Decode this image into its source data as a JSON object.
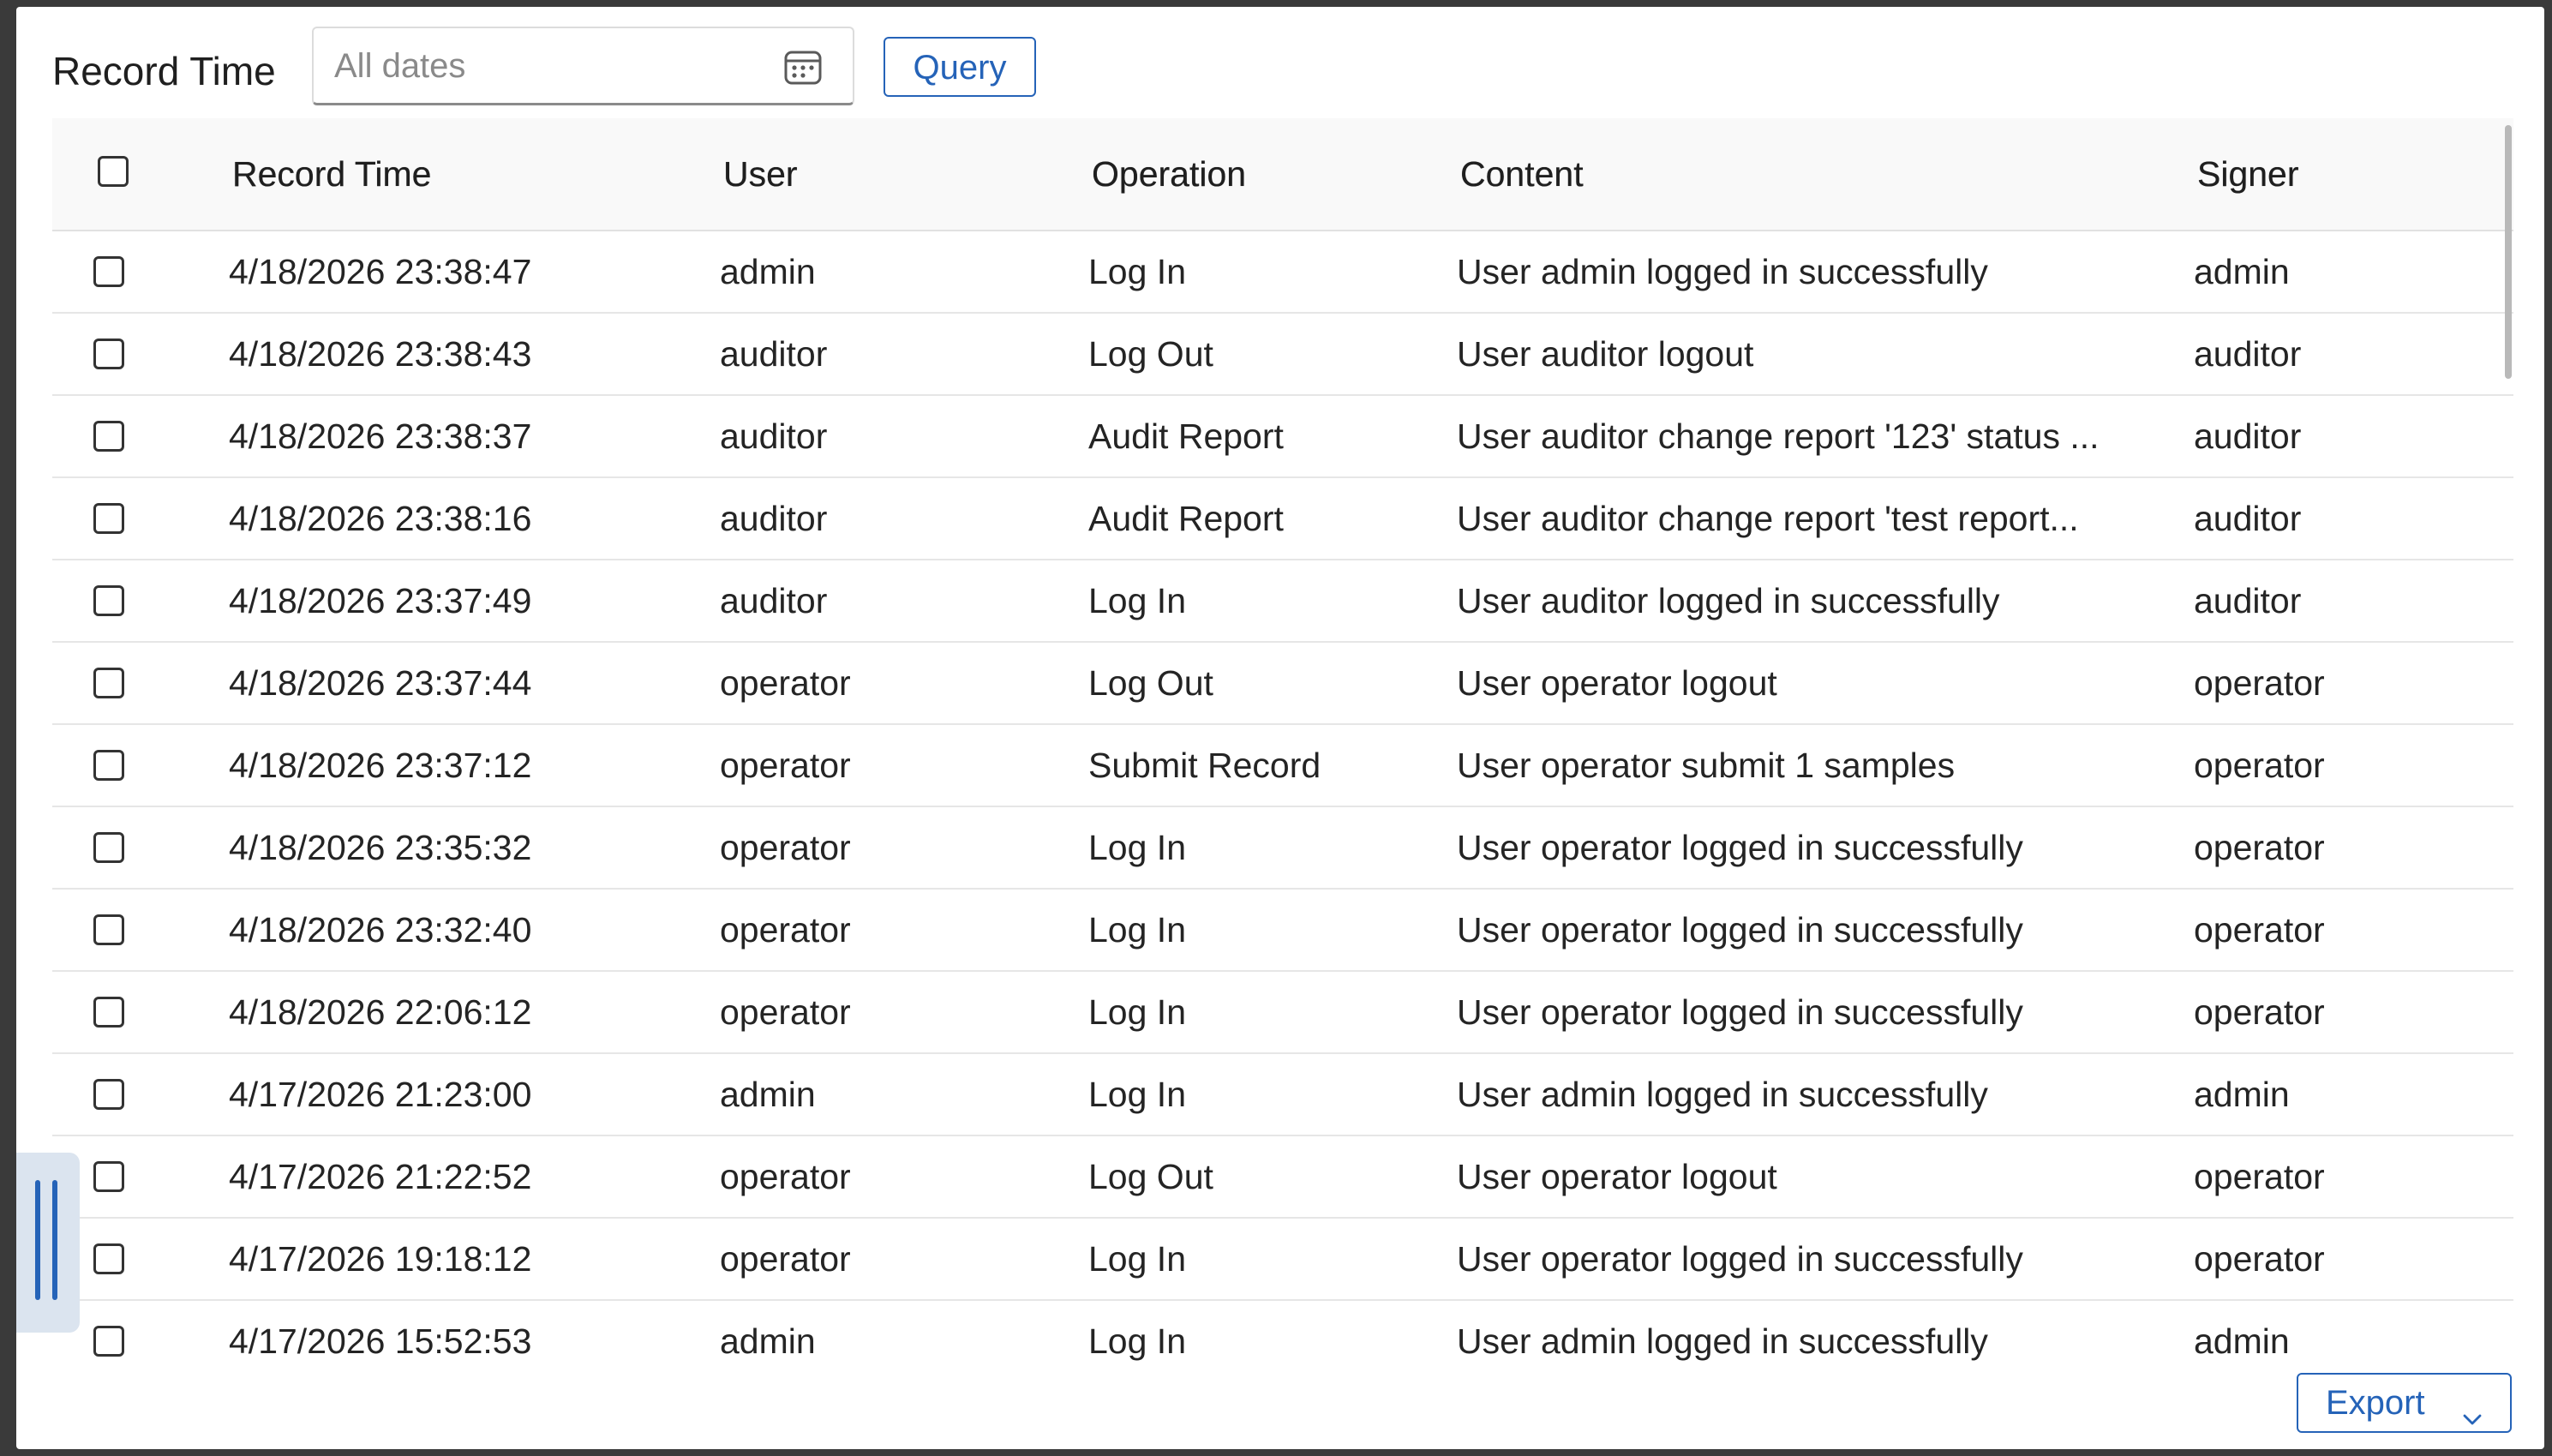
{
  "filter": {
    "label": "Record Time",
    "date_placeholder": "All dates",
    "date_value": "",
    "query_label": "Query"
  },
  "table": {
    "headers": {
      "record_time": "Record Time",
      "user": "User",
      "operation": "Operation",
      "content": "Content",
      "signer": "Signer"
    },
    "rows": [
      {
        "time": "4/18/2026 23:38:47",
        "user": "admin",
        "operation": "Log In",
        "content": "User admin logged in successfully",
        "signer": "admin"
      },
      {
        "time": "4/18/2026 23:38:43",
        "user": "auditor",
        "operation": "Log Out",
        "content": "User auditor logout",
        "signer": "auditor"
      },
      {
        "time": "4/18/2026 23:38:37",
        "user": "auditor",
        "operation": "Audit Report",
        "content": "User auditor change report '123' status ...",
        "signer": "auditor"
      },
      {
        "time": "4/18/2026 23:38:16",
        "user": "auditor",
        "operation": "Audit Report",
        "content": "User auditor change report 'test report...",
        "signer": "auditor"
      },
      {
        "time": "4/18/2026 23:37:49",
        "user": "auditor",
        "operation": "Log In",
        "content": "User auditor logged in successfully",
        "signer": "auditor"
      },
      {
        "time": "4/18/2026 23:37:44",
        "user": "operator",
        "operation": "Log Out",
        "content": "User operator logout",
        "signer": "operator"
      },
      {
        "time": "4/18/2026 23:37:12",
        "user": "operator",
        "operation": "Submit Record",
        "content": "User operator submit 1 samples",
        "signer": "operator"
      },
      {
        "time": "4/18/2026 23:35:32",
        "user": "operator",
        "operation": "Log In",
        "content": "User operator logged in successfully",
        "signer": "operator"
      },
      {
        "time": "4/18/2026 23:32:40",
        "user": "operator",
        "operation": "Log In",
        "content": "User operator logged in successfully",
        "signer": "operator"
      },
      {
        "time": "4/18/2026 22:06:12",
        "user": "operator",
        "operation": "Log In",
        "content": "User operator logged in successfully",
        "signer": "operator"
      },
      {
        "time": "4/17/2026 21:23:00",
        "user": "admin",
        "operation": "Log In",
        "content": "User admin logged in successfully",
        "signer": "admin"
      },
      {
        "time": "4/17/2026 21:22:52",
        "user": "operator",
        "operation": "Log Out",
        "content": "User operator logout",
        "signer": "operator"
      },
      {
        "time": "4/17/2026 19:18:12",
        "user": "operator",
        "operation": "Log In",
        "content": "User operator logged in successfully",
        "signer": "operator"
      },
      {
        "time": "4/17/2026 15:52:53",
        "user": "admin",
        "operation": "Log In",
        "content": "User admin logged in successfully",
        "signer": "admin"
      }
    ]
  },
  "footer": {
    "export_label": "Export"
  },
  "icons": {
    "date_picker": "calendar-icon",
    "export_menu": "chevron-down-icon",
    "splitter": "drag-handle-icon"
  },
  "colors": {
    "accent": "#2563b8",
    "header_bg": "#f9f9f9",
    "row_border": "#e6e6e6"
  }
}
